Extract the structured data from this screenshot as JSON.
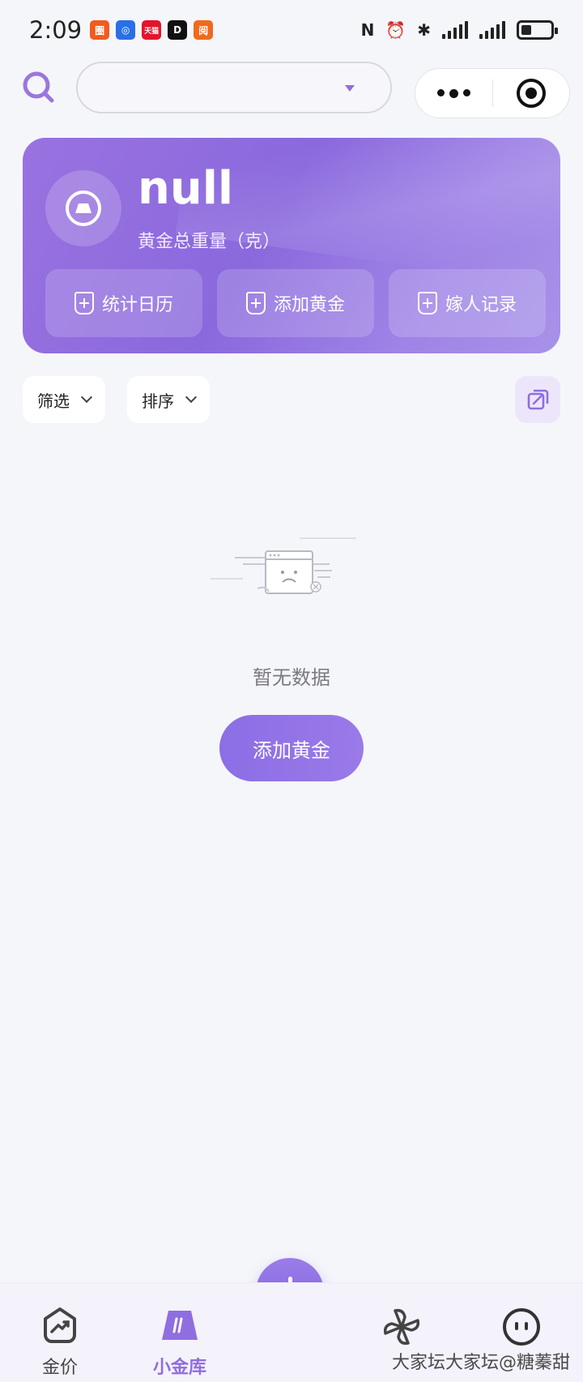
{
  "status_bar": {
    "time": "2:09",
    "apps": [
      {
        "text": "圈",
        "color": "#f25b1c"
      },
      {
        "text": "◎",
        "color": "#2a6ee8"
      },
      {
        "text": "天猫",
        "color": "#e3152b"
      },
      {
        "text": "D",
        "color": "#111111"
      },
      {
        "text": "阅",
        "color": "#f06a1e"
      }
    ],
    "icons": [
      "nfc-icon",
      "alarm-icon",
      "bluetooth-icon",
      "signal-icon",
      "battery-icon"
    ]
  },
  "header": {
    "search_icon": "search-icon",
    "dropdown_value": ""
  },
  "summary_card": {
    "total_weight": "null",
    "total_label": "黄金总重量（克）",
    "actions": [
      {
        "label": "统计日历"
      },
      {
        "label": "添加黄金"
      },
      {
        "label": "嫁人记录"
      }
    ]
  },
  "filters": {
    "filter_label": "筛选",
    "sort_label": "排序"
  },
  "empty_state": {
    "message": "暂无数据",
    "button_label": "添加黄金"
  },
  "tabbar": {
    "tabs": [
      {
        "label": "金价",
        "icon": "trend-icon"
      },
      {
        "label": "小金库",
        "icon": "gold-bar-icon",
        "active": true
      },
      {
        "label": "",
        "icon": "pinwheel-icon"
      },
      {
        "label": "",
        "icon": "face-icon"
      }
    ]
  },
  "watermark": "大家坛大家坛@糖蓁甜",
  "colors": {
    "accent": "#8f6ee0",
    "background": "#f5f6fa"
  }
}
